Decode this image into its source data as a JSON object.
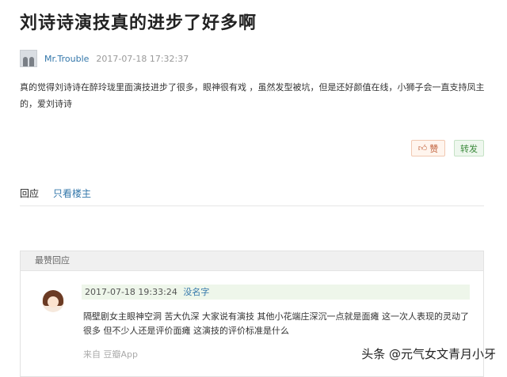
{
  "post": {
    "title": "刘诗诗演技真的进步了好多啊",
    "author": "Mr.Trouble",
    "time": "2017-07-18 17:32:37",
    "body": "真的觉得刘诗诗在醉玲珑里面演技进步了很多，眼神很有戏 ，虽然发型被坑，但是还好颜值在线，小狮子会一直支持凤主的，爱刘诗诗"
  },
  "actions": {
    "like_label": "赞",
    "like_icon": "thumbs-up-icon",
    "share_label": "转发"
  },
  "tabs": {
    "reply": "回应",
    "op_only": "只看楼主"
  },
  "best_replies": {
    "header": "最赞回应",
    "comment": {
      "time": "2017-07-18 19:33:24",
      "user": "没名字",
      "text": "隔壁剧女主眼神空洞 苦大仇深 大家说有演技 其他小花端庄深沉一点就是面瘫 这一次人表现的灵动了很多 但不少人还是评价面瘫 这演技的评价标准是什么",
      "source": "来自 豆瓣App"
    }
  },
  "watermark": "头条 @元气女文青月小牙"
}
